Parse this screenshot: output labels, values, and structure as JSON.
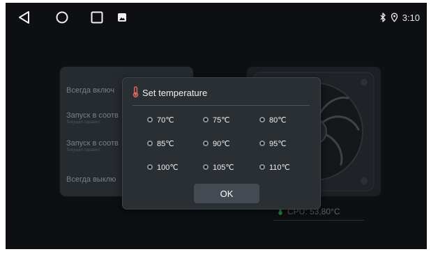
{
  "status": {
    "time": "3:10"
  },
  "icons": {
    "back": "back-triangle-icon",
    "home": "home-circle-icon",
    "recent": "recent-apps-square-icon",
    "screenshot": "screenshot-icon",
    "bluetooth": "bluetooth-icon",
    "location": "location-icon",
    "thermometer": "thermometer-icon",
    "cpu_indicator": "thermometer-icon"
  },
  "background_settings": {
    "options": [
      {
        "label": "Всегда включ",
        "sublabel": ""
      },
      {
        "label": "Запуск в соотв",
        "sublabel": "Текущая парамет"
      },
      {
        "label": "Запуск в соотв",
        "sublabel": "Текущая парамет"
      },
      {
        "label": "Всегда выклю",
        "sublabel": ""
      }
    ]
  },
  "cpu": {
    "label": "CPU: 53,80°C"
  },
  "dialog": {
    "title": "Set temperature",
    "options": [
      "70℃",
      "75℃",
      "80℃",
      "85℃",
      "90℃",
      "95℃",
      "100℃",
      "105℃",
      "110℃"
    ],
    "ok_label": "OK"
  },
  "colors": {
    "screen_bg": "#0d0f12",
    "dialog_bg": "#2a2f34",
    "accent_red": "#e36a5f",
    "cpu_green": "#2e8a3e"
  }
}
